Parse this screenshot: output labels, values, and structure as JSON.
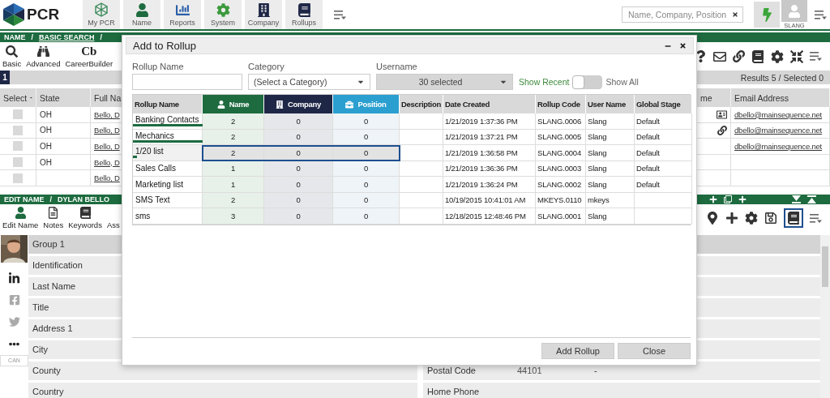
{
  "header": {
    "logo": "PCR",
    "nav": [
      {
        "label": "My PCR",
        "kind": "hub"
      },
      {
        "label": "Name",
        "kind": "person"
      },
      {
        "label": "Reports",
        "kind": "chart"
      },
      {
        "label": "System",
        "kind": "gear"
      },
      {
        "label": "Company",
        "kind": "building"
      },
      {
        "label": "Rollups",
        "kind": "notebook"
      }
    ],
    "search": {
      "placeholder": "Name, Company, Position"
    },
    "user": "SLANG"
  },
  "search_pane": {
    "breadcrumb": [
      {
        "text": "NAME",
        "kind": "plain"
      },
      {
        "text": "/",
        "kind": "sep"
      },
      {
        "text": "BASIC SEARCH",
        "kind": "link"
      },
      {
        "text": "/",
        "kind": "sep"
      }
    ],
    "tools": [
      {
        "label": "Basic",
        "kind": "search"
      },
      {
        "label": "Advanced",
        "kind": "binoculars"
      },
      {
        "label": "CareerBuilder",
        "kind": "glyph",
        "glyph": "Cb"
      }
    ],
    "page": "1",
    "results": "Results 5 / Selected 0",
    "columns": [
      "Select",
      "State",
      "Full Na",
      "me",
      "Email Address"
    ],
    "rows": [
      {
        "checked": false,
        "state": "OH",
        "full_name": "Bello, D",
        "kind": "contact",
        "email": "dbello@mainsequence.net"
      },
      {
        "checked": false,
        "state": "OH",
        "full_name": "Bello, D",
        "kind": "linked",
        "email": "dbello@mainsequence.net"
      },
      {
        "checked": false,
        "state": "OH",
        "full_name": "Bello, D",
        "email": "dbello@mainsequence.net"
      },
      {
        "checked": false,
        "state": "OH",
        "full_name": "Bello, D"
      },
      {
        "checked": false,
        "full_name": "Bello, D"
      }
    ]
  },
  "edit_pane": {
    "breadcrumb": [
      "EDIT NAME",
      "/",
      "DYLAN BELLO"
    ],
    "tools": [
      {
        "label": "Edit Name",
        "kind": "person"
      },
      {
        "label": "Notes",
        "kind": "note"
      },
      {
        "label": "Keywords",
        "kind": "book"
      },
      {
        "label": "Ass",
        "kind": "none"
      }
    ],
    "photo": {
      "kind": "picture"
    },
    "profile_tag": "CAN",
    "fields": [
      {
        "label": "Group 1",
        "kind": "group"
      },
      {
        "label": "Identification",
        "kind": "field"
      },
      {
        "label": "Last Name",
        "kind": "field"
      },
      {
        "label": "Title",
        "kind": "field"
      },
      {
        "label": "Address 1",
        "kind": "field"
      },
      {
        "label": "City",
        "kind": "field"
      },
      {
        "label": "County",
        "kind": "field"
      },
      {
        "label": "Country",
        "kind": "field"
      }
    ],
    "right_fields": [
      {
        "kind": "group"
      },
      {
        "kind": "field"
      },
      {
        "kind": "field"
      },
      {
        "kind": "field"
      },
      {
        "kind": "field"
      },
      {
        "kind": "field"
      },
      {
        "kind": "field",
        "label": "Postal Code",
        "value": "44101",
        "extra": "-"
      },
      {
        "kind": "field",
        "label": "Home Phone"
      }
    ]
  },
  "dialog": {
    "title": "Add to Rollup",
    "rollup_name": {
      "label": "Rollup Name"
    },
    "category": {
      "label": "Category",
      "value": "(Select a Category)"
    },
    "username": {
      "label": "Username",
      "value": "30 selected"
    },
    "toggle": {
      "left": "Show Recent",
      "right": "Show All",
      "show_all": false
    },
    "columns": [
      {
        "label": "Rollup Name",
        "kind": "plain"
      },
      {
        "label": "Name",
        "kind": "name"
      },
      {
        "label": "Company",
        "kind": "company"
      },
      {
        "label": "Position",
        "kind": "position"
      },
      {
        "label": "Description",
        "kind": "plain"
      },
      {
        "label": "Date Created",
        "kind": "plain"
      },
      {
        "label": "Rollup Code",
        "kind": "plain"
      },
      {
        "label": "User Name",
        "kind": "plain"
      },
      {
        "label": "Global Stage",
        "kind": "plain"
      }
    ],
    "rows": [
      {
        "cells": [
          "Banking Contacts",
          "2",
          "0",
          "0",
          null,
          "1/21/2019 1:37:36 PM",
          "SLANG.0006",
          "Slang",
          "Default"
        ],
        "level": 1,
        "selected": false
      },
      {
        "cells": [
          "Mechanics",
          "2",
          "0",
          "0",
          null,
          "1/21/2019 1:37:21 PM",
          "SLANG.0005",
          "Slang",
          "Default"
        ],
        "level": 1,
        "selected": false
      },
      {
        "cells": [
          "1/20 list",
          "2",
          "0",
          "0",
          null,
          "1/21/2019 1:36:58 PM",
          "SLANG.0004",
          "Slang",
          "Default"
        ],
        "level": 0.06,
        "selected": true
      },
      {
        "cells": [
          "Sales Calls",
          "1",
          "0",
          "0",
          null,
          "1/21/2019 1:36:36 PM",
          "SLANG.0003",
          "Slang",
          "Default"
        ],
        "selected": false
      },
      {
        "cells": [
          "Marketing list",
          "1",
          "0",
          "0",
          null,
          "1/21/2019 1:36:24 PM",
          "SLANG.0002",
          "Slang",
          "Default"
        ],
        "selected": false
      },
      {
        "cells": [
          "SMS Text",
          "2",
          "0",
          "0",
          null,
          "10/19/2015 10:41:01 AM",
          "MKEYS.0110",
          "mkeys",
          null
        ],
        "selected": false
      },
      {
        "cells": [
          "sms",
          "3",
          "0",
          "0",
          null,
          "12/18/2015 12:48:46 PM",
          "SLANG.0001",
          "Slang",
          null
        ],
        "selected": false
      }
    ],
    "buttons": [
      "Add Rollup",
      "Close"
    ]
  }
}
